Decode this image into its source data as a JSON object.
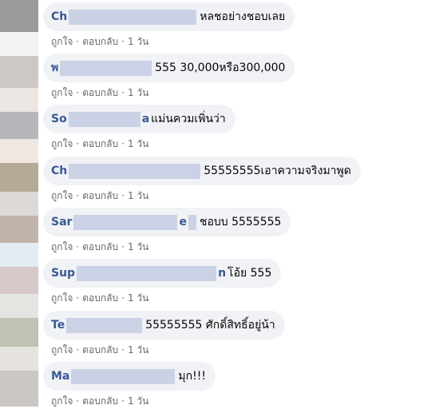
{
  "comments": [
    {
      "name_visible": "Ch",
      "tail": "",
      "text": "หลชอย่างชอบเลย",
      "like": "ถูกใจ",
      "reply": "ตอบกลับ",
      "time": "1 วัน"
    },
    {
      "name_visible": "พ",
      "tail": "",
      "text": "555 30,000หรือ300,000",
      "like": "ถูกใจ",
      "reply": "ตอบกลับ",
      "time": "1 วัน"
    },
    {
      "name_visible": "So",
      "tail": "a",
      "text": "แม่นควมเพิ่นว่า",
      "like": "ถูกใจ",
      "reply": "ตอบกลับ",
      "time": "1 วัน"
    },
    {
      "name_visible": "Ch",
      "tail": "",
      "text": "55555555เอาความจริงมาพูด",
      "like": "ถูกใจ",
      "reply": "ตอบกลับ",
      "time": "1 วัน"
    },
    {
      "name_visible": "Sar",
      "tail": "e",
      "text": "ชอบบ 5555555",
      "like": "ถูกใจ",
      "reply": "ตอบกลับ",
      "time": "1 วัน"
    },
    {
      "name_visible": "Sup",
      "tail": "n",
      "text": "โอ้ย 555",
      "like": "ถูกใจ",
      "reply": "ตอบกลับ",
      "time": "1 วัน"
    },
    {
      "name_visible": "Te",
      "tail": "",
      "text": "55555555 ศักดิ์สิทธิ์อยู่น้า",
      "like": "ถูกใจ",
      "reply": "ตอบกลับ",
      "time": "1 วัน"
    },
    {
      "name_visible": "Ma",
      "tail": "",
      "text": "มุก!!!",
      "like": "ถูกใจ",
      "reply": "ตอบกลับ",
      "time": "1 วัน"
    }
  ],
  "colors": {
    "bubble": "#f0f2f5",
    "name": "#385898",
    "meta": "#65676b",
    "blur": "#c9cfe3"
  }
}
